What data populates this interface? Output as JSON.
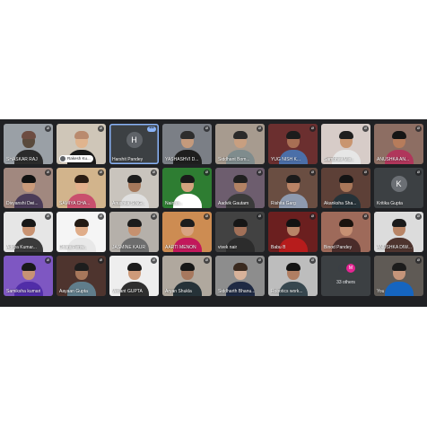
{
  "participants": [
    {
      "name": "SHASKAR RAJ",
      "muted": true
    },
    {
      "name": "Rakesh Ku...",
      "muted": true,
      "pill": true
    },
    {
      "name": "Harshit Pandey",
      "muted": false,
      "initial": "H",
      "avatar_color": "#5f6368",
      "active": true,
      "badge": "•••"
    },
    {
      "name": "YASHASHVI D...",
      "muted": true
    },
    {
      "name": "Siddhant Bom...",
      "muted": true
    },
    {
      "name": "YUG NISH K...",
      "muted": true
    },
    {
      "name": "Sambhav Mis...",
      "muted": true
    },
    {
      "name": "ANUSHKA AN...",
      "muted": true
    },
    {
      "name": "Divyanshi Dwi...",
      "muted": true
    },
    {
      "name": "SAMIYA CHA...",
      "muted": true
    },
    {
      "name": "Anushka SING...",
      "muted": true
    },
    {
      "name": "Nainaa...",
      "muted": true
    },
    {
      "name": "Aadvik Gautam",
      "muted": true
    },
    {
      "name": "Rishita Garg",
      "muted": true
    },
    {
      "name": "Akanksha Sha...",
      "muted": true
    },
    {
      "name": "Kritika Gupta",
      "muted": true,
      "initial": "K",
      "avatar_color": "#6b6f74"
    },
    {
      "name": "Aditya Kumar...",
      "muted": true
    },
    {
      "name": "Dhara Periw...",
      "muted": true
    },
    {
      "name": "JASMINE KAUR",
      "muted": true
    },
    {
      "name": "AARTI MENON",
      "muted": true
    },
    {
      "name": "vivek nair",
      "muted": true
    },
    {
      "name": "Babu B",
      "muted": true
    },
    {
      "name": "Binod Pandey",
      "muted": true
    },
    {
      "name": "ANUSHKA DIW...",
      "muted": true
    },
    {
      "name": "Samiksha kumari",
      "muted": true
    },
    {
      "name": "Aayaan Gupta",
      "muted": true
    },
    {
      "name": "Vedant GUPTA",
      "muted": true
    },
    {
      "name": "Aryan Shukla",
      "muted": true
    },
    {
      "name": "Siddharth Bhanu...",
      "muted": true
    },
    {
      "name": "Robotics work...",
      "muted": true
    },
    {
      "name": "33 others",
      "others": true
    },
    {
      "name": "You",
      "muted": true
    }
  ],
  "others_avatars": [
    {
      "letter": "",
      "color": "#3b3f44"
    },
    {
      "letter": "M",
      "color": "#e52592"
    }
  ],
  "colors": {
    "call_background": "#202124",
    "tile_background": "#3c4043",
    "active_border": "#8ab4f8"
  }
}
